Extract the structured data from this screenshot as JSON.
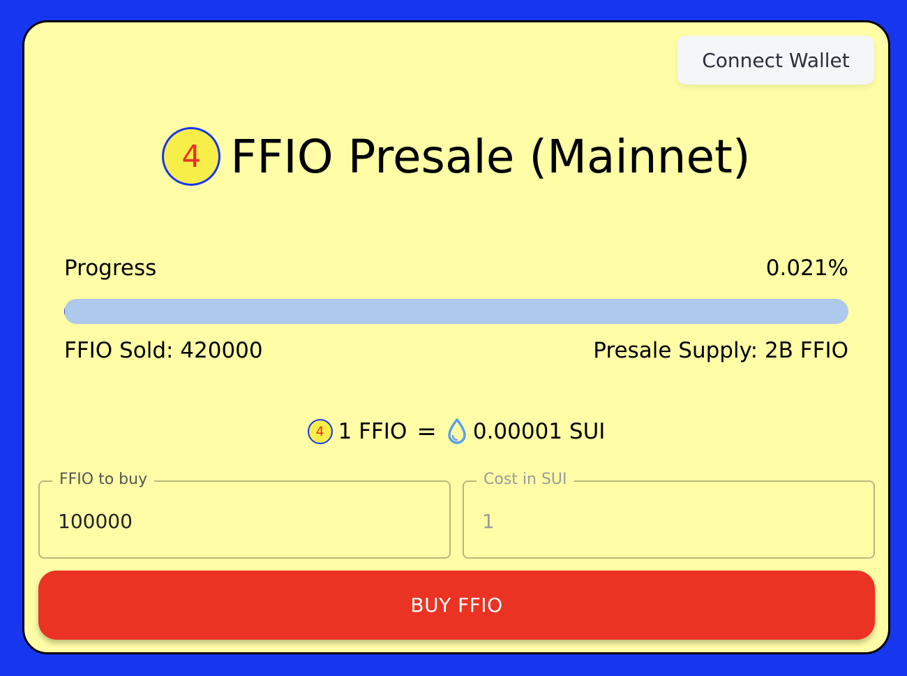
{
  "header": {
    "connect_wallet_label": "Connect Wallet"
  },
  "title": {
    "coin_symbol": "4",
    "text": "FFIO Presale (Mainnet)"
  },
  "progress": {
    "label": "Progress",
    "percent_text": "0.021%",
    "fraction": 0.00021,
    "sold_text": "FFIO Sold: 420000",
    "supply_text": "Presale Supply: 2B FFIO"
  },
  "rate": {
    "left_amount": "1 FFIO",
    "equals": "=",
    "right_amount": "0.00001 SUI",
    "left_icon": "ffio-coin-icon",
    "right_icon": "sui-drop-icon"
  },
  "form": {
    "ffio_label": "FFIO to buy",
    "ffio_value": "100000",
    "cost_label": "Cost in SUI",
    "cost_value": "1"
  },
  "buy_button_label": "BUY FFIO",
  "colors": {
    "background": "#1736f0",
    "card": "#fffea6",
    "accent_red": "#ea3323",
    "progress_track": "#aec9ec",
    "coin_yellow": "#f7ee4a"
  }
}
